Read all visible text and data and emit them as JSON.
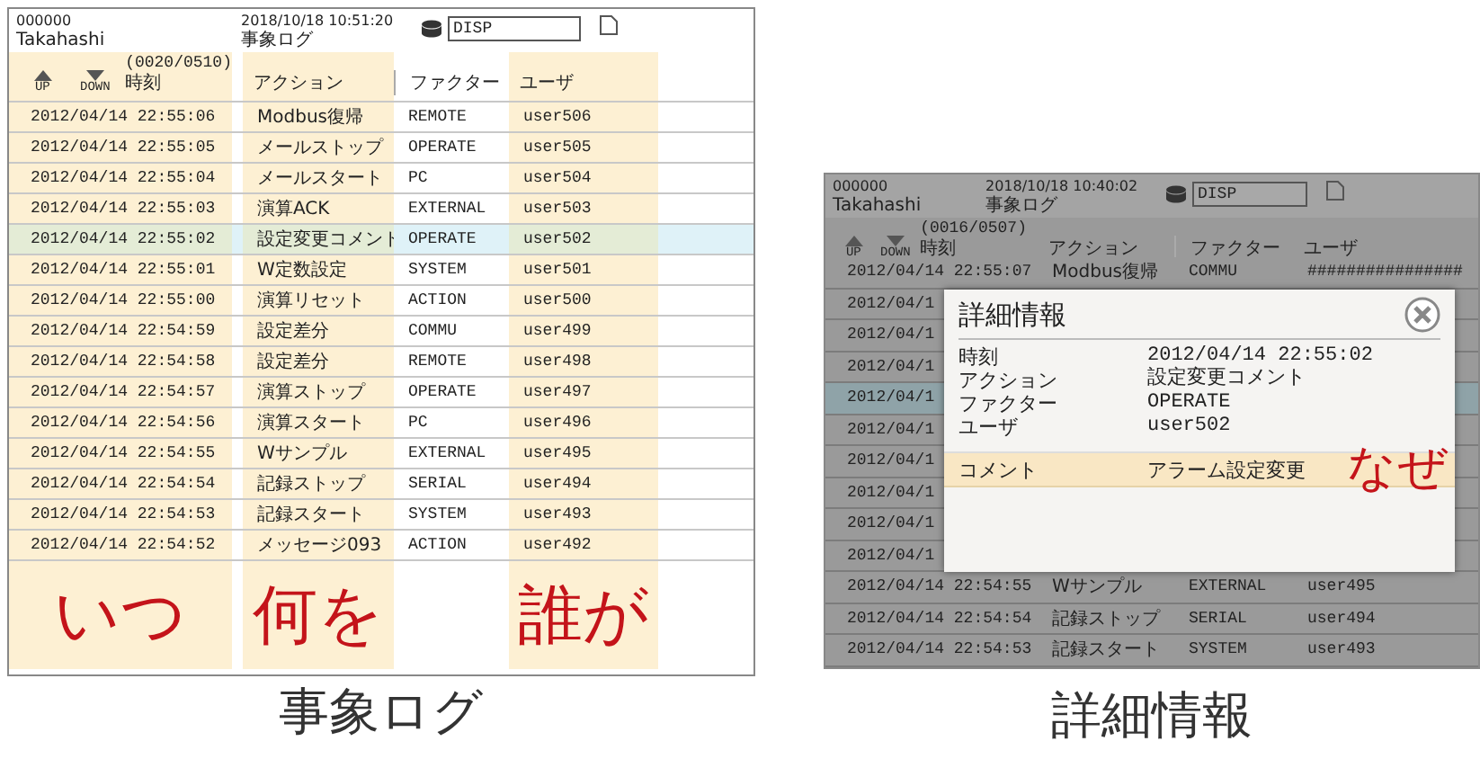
{
  "screens": [
    {
      "caption": "事象ログ",
      "header": {
        "id": "000000",
        "user": "Takahashi",
        "datetime": "2018/10/18 10:51:20",
        "title": "事象ログ",
        "mode": "DISP",
        "up": "UP",
        "down": "DOWN",
        "count": "(0020/0510)"
      },
      "columns": [
        {
          "label": "時刻",
          "highlight": true,
          "annotation": "いつ"
        },
        {
          "label": "アクション",
          "highlight": true,
          "annotation": "何を"
        },
        {
          "label": "ファクター",
          "highlight": false
        },
        {
          "label": "ユーザ",
          "highlight": true,
          "annotation": "誰が"
        }
      ],
      "rows": [
        {
          "time": "2012/04/14 22:55:06",
          "action": "Modbus復帰",
          "factor": "REMOTE",
          "user": "user506",
          "selected": false
        },
        {
          "time": "2012/04/14 22:55:05",
          "action": "メールストップ",
          "factor": "OPERATE",
          "user": "user505",
          "selected": false
        },
        {
          "time": "2012/04/14 22:55:04",
          "action": "メールスタート",
          "factor": "PC",
          "user": "user504",
          "selected": false
        },
        {
          "time": "2012/04/14 22:55:03",
          "action": "演算ACK",
          "factor": "EXTERNAL",
          "user": "user503",
          "selected": false
        },
        {
          "time": "2012/04/14 22:55:02",
          "action": "設定変更コメント",
          "factor": "OPERATE",
          "user": "user502",
          "selected": true
        },
        {
          "time": "2012/04/14 22:55:01",
          "action": "W定数設定",
          "factor": "SYSTEM",
          "user": "user501",
          "selected": false
        },
        {
          "time": "2012/04/14 22:55:00",
          "action": "演算リセット",
          "factor": "ACTION",
          "user": "user500",
          "selected": false
        },
        {
          "time": "2012/04/14 22:54:59",
          "action": "設定差分",
          "factor": "COMMU",
          "user": "user499",
          "selected": false
        },
        {
          "time": "2012/04/14 22:54:58",
          "action": "設定差分",
          "factor": "REMOTE",
          "user": "user498",
          "selected": false
        },
        {
          "time": "2012/04/14 22:54:57",
          "action": "演算ストップ",
          "factor": "OPERATE",
          "user": "user497",
          "selected": false
        },
        {
          "time": "2012/04/14 22:54:56",
          "action": "演算スタート",
          "factor": "PC",
          "user": "user496",
          "selected": false
        },
        {
          "time": "2012/04/14 22:54:55",
          "action": "Wサンプル",
          "factor": "EXTERNAL",
          "user": "user495",
          "selected": false
        },
        {
          "time": "2012/04/14 22:54:54",
          "action": "記録ストップ",
          "factor": "SERIAL",
          "user": "user494",
          "selected": false
        },
        {
          "time": "2012/04/14 22:54:53",
          "action": "記録スタート",
          "factor": "SYSTEM",
          "user": "user493",
          "selected": false
        },
        {
          "time": "2012/04/14 22:54:52",
          "action": "メッセージ093",
          "factor": "ACTION",
          "user": "user492",
          "selected": false
        }
      ]
    },
    {
      "caption": "詳細情報",
      "header": {
        "id": "000000",
        "user": "Takahashi",
        "datetime": "2018/10/18 10:40:02",
        "title": "事象ログ",
        "mode": "DISP",
        "up": "UP",
        "down": "DOWN",
        "count": "(0016/0507)"
      },
      "columns": [
        {
          "label": "時刻"
        },
        {
          "label": "アクション"
        },
        {
          "label": "ファクター"
        },
        {
          "label": "ユーザ"
        }
      ],
      "rows": [
        {
          "time": "2012/04/14 22:55:07",
          "action": "Modbus復帰",
          "factor": "COMMU",
          "user": "################",
          "selected": false
        },
        {
          "time": "2012/04/1",
          "selected": false
        },
        {
          "time": "2012/04/1",
          "selected": false
        },
        {
          "time": "2012/04/1",
          "selected": false
        },
        {
          "time": "2012/04/1",
          "selected": true
        },
        {
          "time": "2012/04/1",
          "selected": false
        },
        {
          "time": "2012/04/1",
          "selected": false
        },
        {
          "time": "2012/04/1",
          "selected": false
        },
        {
          "time": "2012/04/1",
          "selected": false
        },
        {
          "time": "2012/04/1",
          "selected": false
        },
        {
          "time": "2012/04/14 22:54:55",
          "action": "Wサンプル",
          "factor": "EXTERNAL",
          "user": "user495",
          "selected": false
        },
        {
          "time": "2012/04/14 22:54:54",
          "action": "記録ストップ",
          "factor": "SERIAL",
          "user": "user494",
          "selected": false
        },
        {
          "time": "2012/04/14 22:54:53",
          "action": "記録スタート",
          "factor": "SYSTEM",
          "user": "user493",
          "selected": false
        }
      ],
      "dialog": {
        "title": "詳細情報",
        "fields": [
          {
            "label": "時刻",
            "value": "2012/04/14 22:55:02"
          },
          {
            "label": "アクション",
            "value": "設定変更コメント"
          },
          {
            "label": "ファクター",
            "value": "OPERATE"
          },
          {
            "label": "ユーザ",
            "value": "user502"
          }
        ],
        "comment": {
          "label": "コメント",
          "value": "アラーム設定変更",
          "annotation": "なぜ"
        }
      }
    }
  ]
}
